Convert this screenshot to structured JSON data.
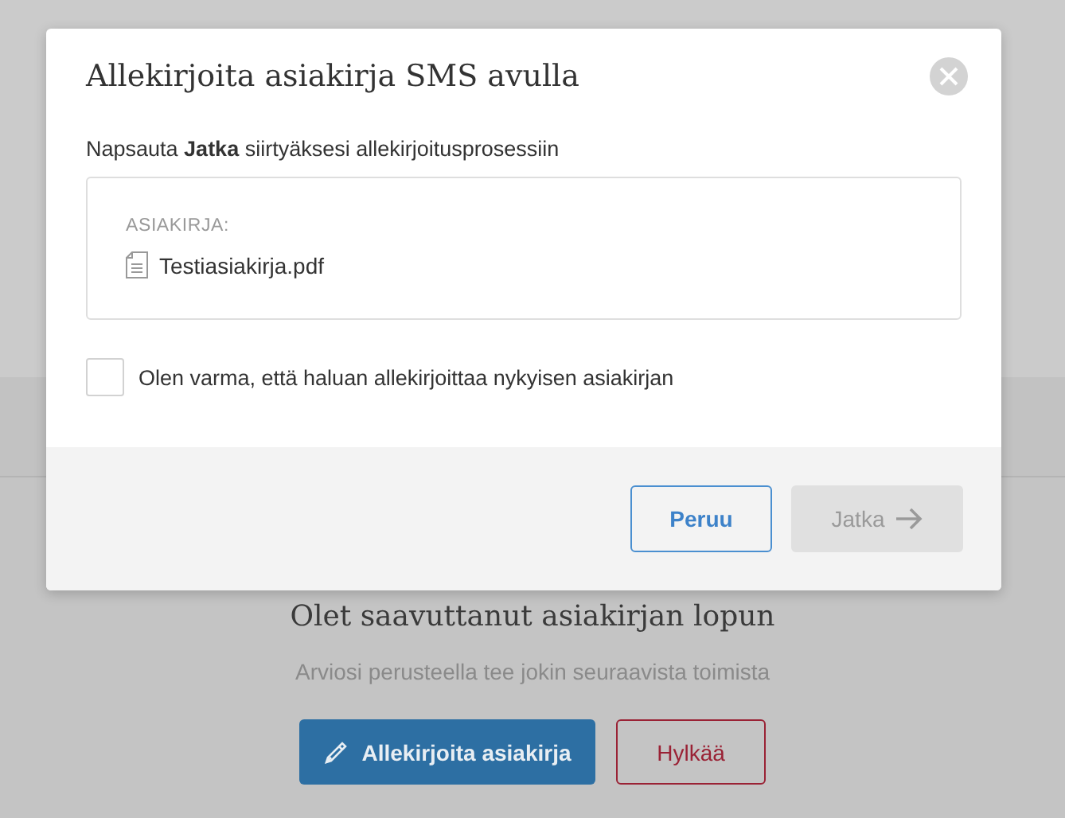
{
  "page": {
    "end_title": "Olet saavuttanut asiakirjan lopun",
    "end_subtitle": "Arviosi perusteella tee jokin seuraavista toimista",
    "sign_button": "Allekirjoita asiakirja",
    "reject_button": "Hylkää"
  },
  "dialog": {
    "title": "Allekirjoita asiakirja SMS avulla",
    "instruction": "Napsauta **Jatka** siirtyäksesi allekirjoitusprosessiin",
    "document_label": "ASIAKIRJA:",
    "document_name": "Testiasiakirja.pdf",
    "confirm": {
      "label": "Olen varma, että haluan allekirjoittaa nykyisen asiakirjan",
      "checked": false
    },
    "buttons": [
      {
        "kind": "cancel",
        "label": "Peruu",
        "disabled": false
      },
      {
        "kind": "continue",
        "label": "Jatka",
        "disabled": true
      }
    ]
  }
}
